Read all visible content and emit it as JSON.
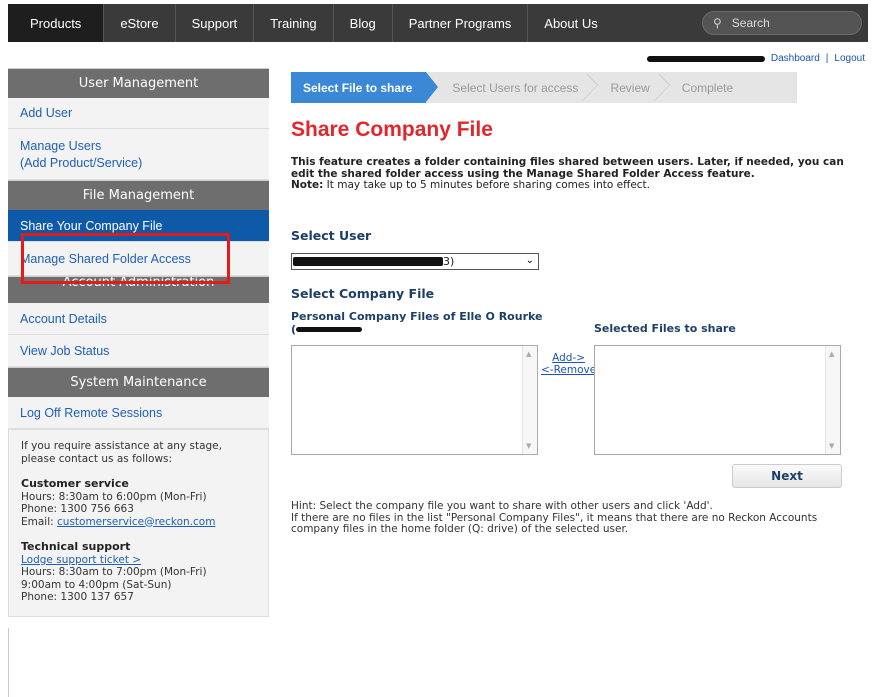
{
  "topnav": {
    "items": [
      "Products",
      "eStore",
      "Support",
      "Training",
      "Blog",
      "Partner Programs",
      "About Us"
    ],
    "active": "Products",
    "search_placeholder": "Search"
  },
  "userbar": {
    "dashboard": "Dashboard",
    "divider": "|",
    "logout": "Logout"
  },
  "sidebar": {
    "user_mgmt_heading": "User Management",
    "add_user": "Add User",
    "manage_users_1": "Manage Users",
    "manage_users_2": "(Add Product/Service)",
    "file_mgmt_heading": "File Management",
    "share_file": "Share Your Company File",
    "manage_shared": "Manage Shared Folder Access",
    "account_admin_heading": "Account Administration",
    "account_details": "Account Details",
    "view_job": "View Job Status",
    "sys_heading": "System Maintenance",
    "log_off": "Log Off Remote Sessions",
    "help": {
      "intro": "If you require assistance at any stage, please contact us as follows:",
      "cs_title": "Customer service",
      "cs_hours": "Hours: 8:30am to 6:00pm (Mon-Fri)",
      "cs_phone": "Phone: 1300 756 663",
      "cs_email_label": "Email: ",
      "cs_email": "customerservice@reckon.com",
      "ts_title": "Technical support",
      "ts_link": "Lodge support ticket >",
      "ts_hours1": "Hours: 8:30am to 7:00pm (Mon-Fri)",
      "ts_hours2": "9:00am to 4:00pm (Sat-Sun)",
      "ts_phone": "Phone: 1300 137 657"
    }
  },
  "wizard": {
    "steps": [
      "Select File to share",
      "Select Users for access",
      "Review",
      "Complete"
    ]
  },
  "main": {
    "title": "Share Company File",
    "intro": "This feature creates a folder containing files shared between users. Later, if needed, you can edit the shared folder access using the Manage Shared Folder Access feature.",
    "note_label": "Note:",
    "note": " It may take up to 5 minutes before sharing comes into effect.",
    "select_user_label": "Select User",
    "select_user_suffix": "3)",
    "select_file_label": "Select Company File",
    "personal_files_label": "Personal Company Files of Elle O Rourke",
    "personal_files_sub": "(",
    "selected_files_label": "Selected Files to share",
    "add": "Add->",
    "remove": "<-Remove",
    "next": "Next",
    "hint1": "Hint: Select the company file you want to share with other users and click 'Add'.",
    "hint2": "If there are no files in the list \"Personal Company Files\", it means that there are no Reckon Accounts company files in the home folder (Q: drive) of the selected user."
  },
  "colors": {
    "nav_bg": "#3a3a3a",
    "sidebar_heading": "#6e6e6e",
    "active_blue": "#0f5aa8",
    "title_red": "#e3262b",
    "highlight_red": "#e41b1b"
  }
}
